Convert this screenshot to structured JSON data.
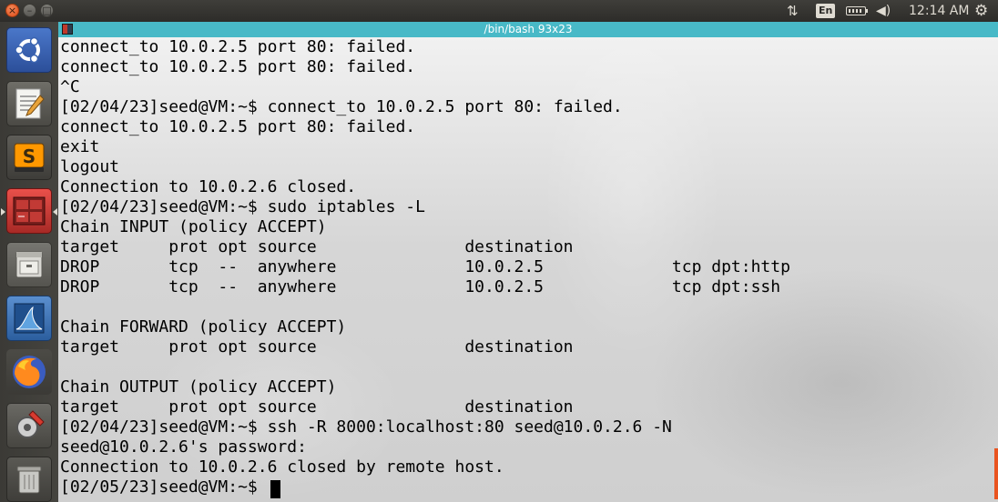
{
  "top_panel": {
    "close_glyph": "×",
    "minimize_glyph": "–",
    "maximize_glyph": "□",
    "network_glyph": "⇅",
    "language": "En",
    "volume_glyph": "◀)",
    "clock": "12:14 AM",
    "settings_glyph": "⚙"
  },
  "launcher": {
    "icons": [
      "ubuntu-dash-icon",
      "text-editor-icon",
      "sublime-text-icon",
      "terminal-icon",
      "file-manager-icon",
      "wireshark-icon",
      "firefox-icon",
      "system-settings-icon",
      "trash-icon"
    ],
    "sublime_glyph": "S"
  },
  "terminal": {
    "title": "/bin/bash 93x23",
    "lines": [
      "connect_to 10.0.2.5 port 80: failed.",
      "connect_to 10.0.2.5 port 80: failed.",
      "^C",
      "[02/04/23]seed@VM:~$ connect_to 10.0.2.5 port 80: failed.",
      "connect_to 10.0.2.5 port 80: failed.",
      "exit",
      "logout",
      "Connection to 10.0.2.6 closed.",
      "[02/04/23]seed@VM:~$ sudo iptables -L",
      "Chain INPUT (policy ACCEPT)",
      "target     prot opt source               destination",
      "DROP       tcp  --  anywhere             10.0.2.5             tcp dpt:http",
      "DROP       tcp  --  anywhere             10.0.2.5             tcp dpt:ssh",
      "",
      "Chain FORWARD (policy ACCEPT)",
      "target     prot opt source               destination",
      "",
      "Chain OUTPUT (policy ACCEPT)",
      "target     prot opt source               destination",
      "[02/04/23]seed@VM:~$ ssh -R 8000:localhost:80 seed@10.0.2.6 -N",
      "seed@10.0.2.6's password:",
      "Connection to 10.0.2.6 closed by remote host.",
      "[02/05/23]seed@VM:~$ "
    ]
  },
  "colors": {
    "titlebar": "#48b9c7",
    "panel": "#3c3b37",
    "accent": "#e95420"
  }
}
